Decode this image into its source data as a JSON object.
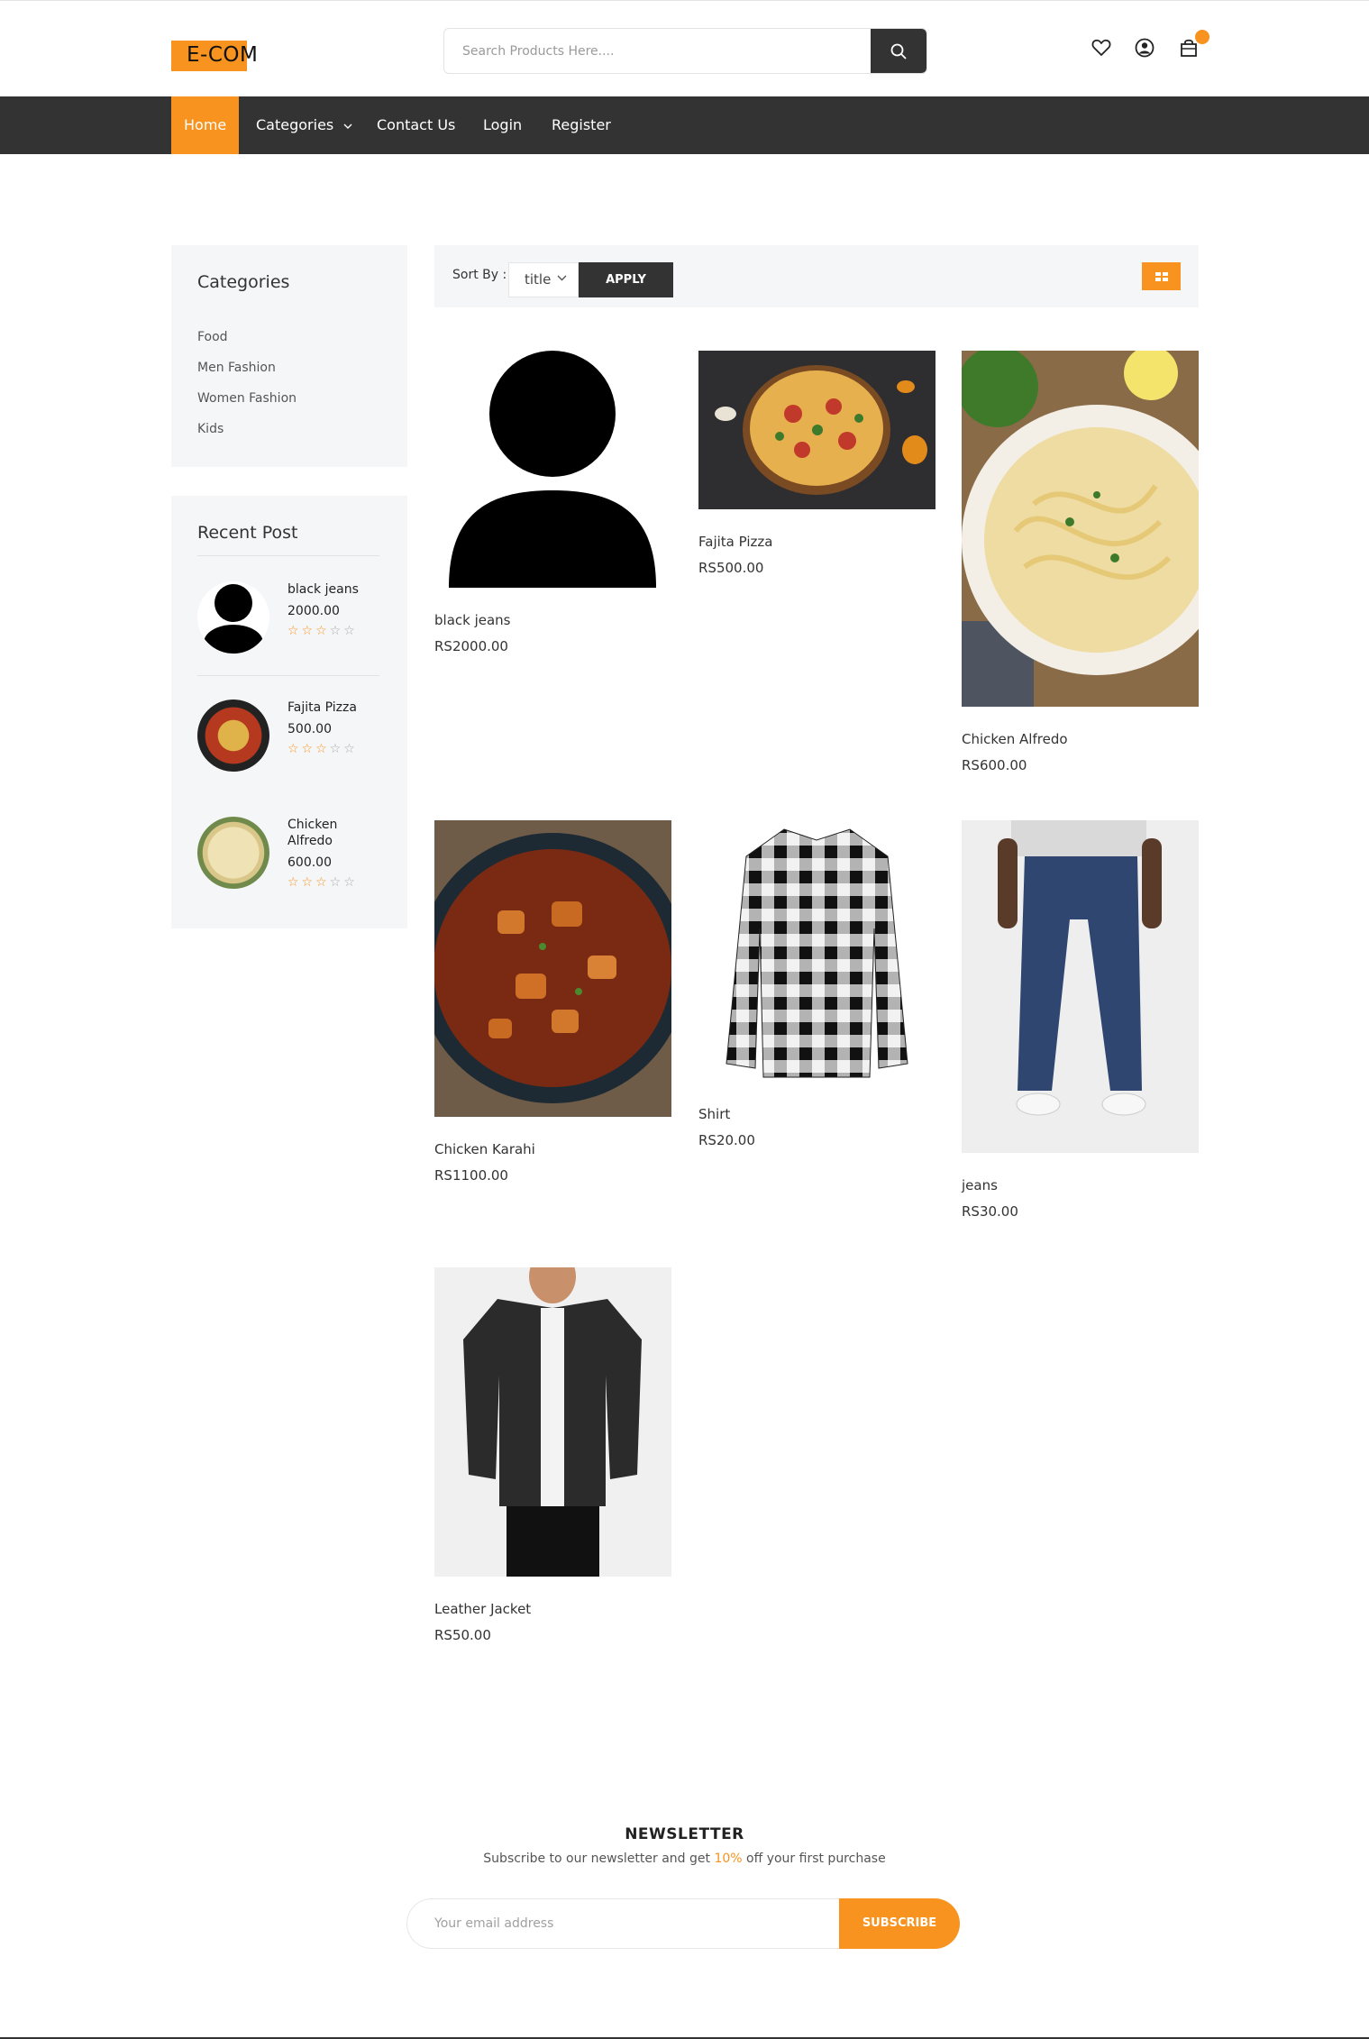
{
  "header": {
    "logo_text": "E-COM",
    "search_placeholder": "Search Products Here....",
    "icons": [
      "heart-icon",
      "user-icon",
      "cart-icon"
    ]
  },
  "nav": {
    "items": [
      {
        "label": "Home",
        "active": true
      },
      {
        "label": "Categories",
        "dropdown": true
      },
      {
        "label": "Contact Us"
      },
      {
        "label": "Login"
      },
      {
        "label": "Register"
      }
    ]
  },
  "sidebar": {
    "categories_title": "Categories",
    "categories": [
      "Food",
      "Men Fashion",
      "Women Fashion",
      "Kids"
    ],
    "recent_title": "Recent Post",
    "recent": [
      {
        "name": "black jeans",
        "price": "2000.00",
        "rating": 3
      },
      {
        "name": "Fajita Pizza",
        "price": "500.00",
        "rating": 3
      },
      {
        "name": "Chicken Alfredo",
        "price": "600.00",
        "rating": 3
      }
    ]
  },
  "toolbar": {
    "sort_label": "Sort By :",
    "sort_value": "title",
    "apply_label": "APPLY"
  },
  "products": [
    {
      "name": "black jeans",
      "price": "RS2000.00"
    },
    {
      "name": "Fajita Pizza",
      "price": "RS500.00"
    },
    {
      "name": "Chicken Alfredo",
      "price": "RS600.00"
    },
    {
      "name": "Chicken Karahi",
      "price": "RS1100.00"
    },
    {
      "name": "Shirt",
      "price": "RS20.00"
    },
    {
      "name": "jeans",
      "price": "RS30.00"
    },
    {
      "name": "Leather Jacket",
      "price": "RS50.00"
    }
  ],
  "newsletter": {
    "title": "NEWSLETTER",
    "sub_before": "Subscribe to our newsletter and get ",
    "sub_highlight": "10%",
    "sub_after": " off your first purchase",
    "email_placeholder": "Your email address",
    "button_label": "SUBSCRIBE"
  },
  "colors": {
    "accent": "#f7931e",
    "dark": "#333333",
    "panel": "#f5f6f8"
  }
}
